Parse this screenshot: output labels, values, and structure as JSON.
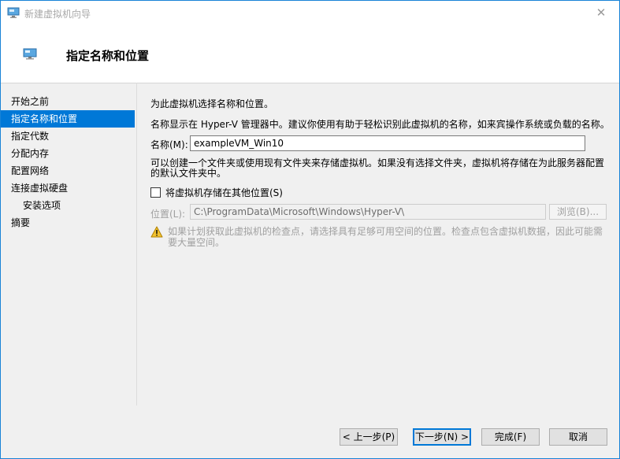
{
  "window": {
    "title": "新建虚拟机向导",
    "close_glyph": "✕"
  },
  "header": {
    "title": "指定名称和位置"
  },
  "nav": {
    "items": [
      {
        "label": "开始之前"
      },
      {
        "label": "指定名称和位置"
      },
      {
        "label": "指定代数"
      },
      {
        "label": "分配内存"
      },
      {
        "label": "配置网络"
      },
      {
        "label": "连接虚拟硬盘"
      },
      {
        "label": "安装选项"
      },
      {
        "label": "摘要"
      }
    ],
    "active_index": 1
  },
  "content": {
    "intro": "为此虚拟机选择名称和位置。",
    "name_desc": "名称显示在 Hyper-V 管理器中。建议你使用有助于轻松识别此虚拟机的名称，如来宾操作系统或负载的名称。",
    "name_label": "名称(M):",
    "name_value": "exampleVM_Win10",
    "folder_desc": "可以创建一个文件夹或使用现有文件夹来存储虚拟机。如果没有选择文件夹，虚拟机将存储在为此服务器配置的默认文件夹中。",
    "store_checkbox_label": "将虚拟机存储在其他位置(S)",
    "store_checkbox_checked": false,
    "location_label": "位置(L):",
    "location_value": "C:\\ProgramData\\Microsoft\\Windows\\Hyper-V\\",
    "browse_label": "浏览(B)...",
    "warning_text": "如果计划获取此虚拟机的检查点，请选择具有足够可用空间的位置。检查点包含虚拟机数据，因此可能需要大量空间。"
  },
  "footer": {
    "prev_label": "< 上一步(P)",
    "next_label": "下一步(N) >",
    "finish_label": "完成(F)",
    "cancel_label": "取消"
  },
  "icons": {
    "app": "vm-monitor-icon",
    "header": "vm-monitor-icon",
    "warning": "warning-triangle-icon"
  },
  "colors": {
    "accent": "#0078d7",
    "window_border": "#1883d7",
    "warning": "#e0a800"
  }
}
